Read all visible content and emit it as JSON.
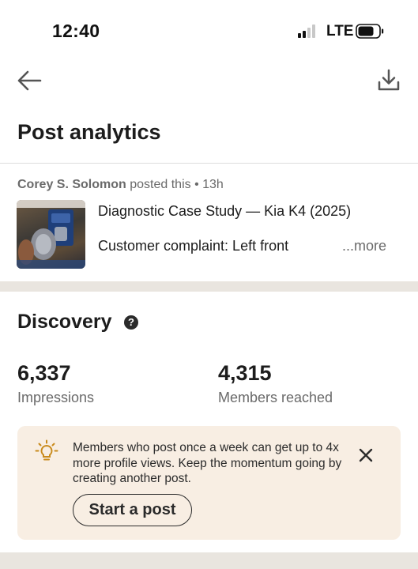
{
  "status_bar": {
    "time": "12:40",
    "network": "LTE",
    "signal_bars_active": 2,
    "signal_bars_total": 4
  },
  "top_nav": {
    "back_icon": "arrow-left-icon",
    "download_icon": "download-icon"
  },
  "page": {
    "title": "Post analytics"
  },
  "post": {
    "author": "Corey S. Solomon",
    "meta": " posted this • 13h",
    "title": "Diagnostic Case Study — Kia K4 (2025)",
    "snippet": "Customer complaint: Left front",
    "more_label": "...more"
  },
  "discovery": {
    "title": "Discovery",
    "help_icon": "question-circle-icon",
    "metrics": [
      {
        "value": "6,337",
        "label": "Impressions"
      },
      {
        "value": "4,315",
        "label": "Members reached"
      }
    ],
    "tip": {
      "icon": "lightbulb-icon",
      "text": "Members who post once a week can get up to 4x more profile views. Keep the momentum going by creating another post.",
      "close_icon": "close-icon",
      "button_label": "Start a post"
    }
  },
  "colors": {
    "background": "#ffffff",
    "section_gap": "#e9e5df",
    "tip_background": "#f8eee3",
    "tip_icon_accent": "#c98a1b",
    "text_primary": "#1c1c1c",
    "text_secondary": "#6a6a6a"
  }
}
